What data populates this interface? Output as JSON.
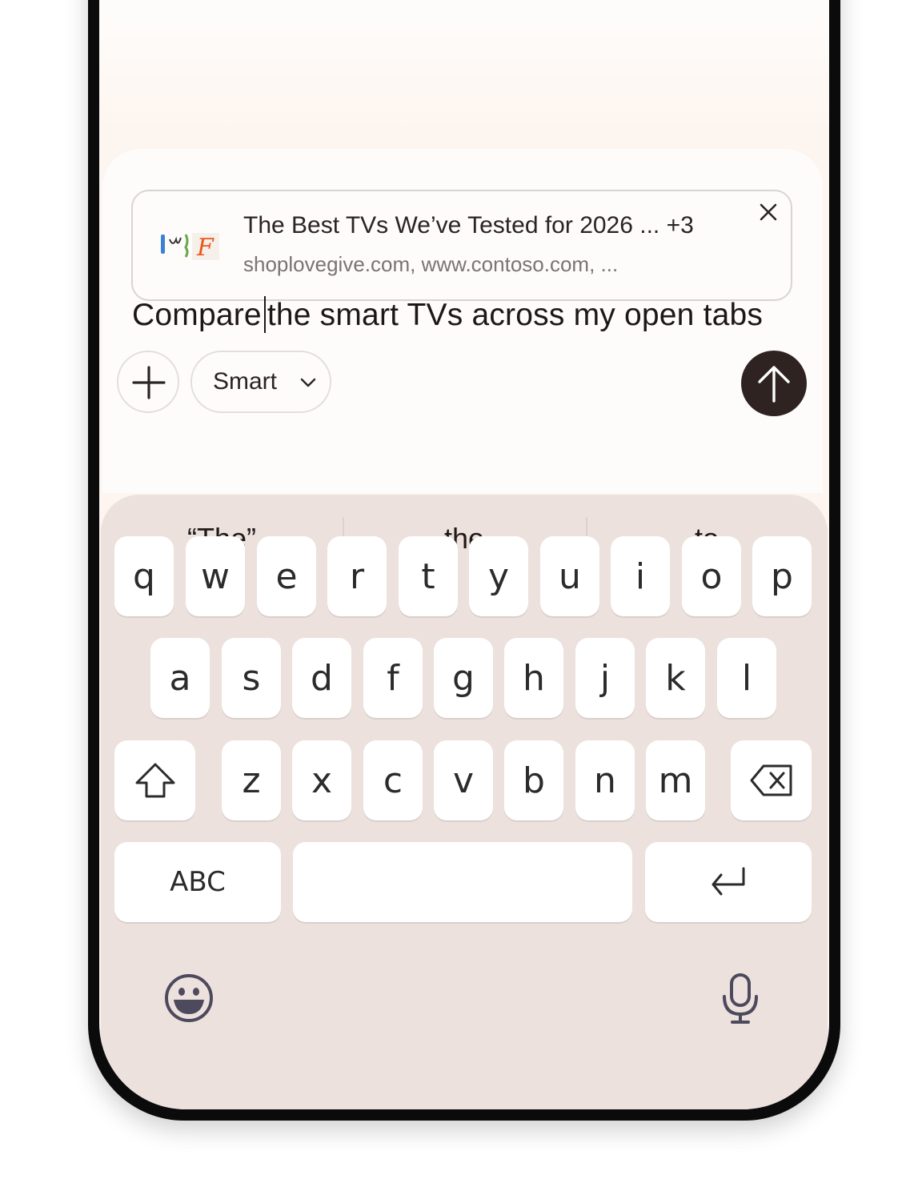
{
  "attached_tabs": {
    "title": "The Best TVs We’ve Tested for 2026 ... +3",
    "sites": "shoplovegive.com, www.contoso.com, ...",
    "favicon_icons": [
      "blue-bar-favicon",
      "leaf-sketch-favicon",
      "green-sprig-favicon",
      "orange-f-favicon"
    ]
  },
  "prompt": {
    "before_caret": "Compare",
    "after_caret": "the smart TVs across my open tabs"
  },
  "composer": {
    "mode_label": "Smart",
    "add_icon": "plus-icon",
    "mode_icon": "chevron-down-icon",
    "send_icon": "arrow-up-icon"
  },
  "keyboard": {
    "suggestions": [
      "“The”",
      "the",
      "to"
    ],
    "row1": [
      "q",
      "w",
      "e",
      "r",
      "t",
      "y",
      "u",
      "i",
      "o",
      "p"
    ],
    "row2": [
      "a",
      "s",
      "d",
      "f",
      "g",
      "h",
      "j",
      "k",
      "l"
    ],
    "row3": [
      "z",
      "x",
      "c",
      "v",
      "b",
      "n",
      "m"
    ],
    "abc_label": "ABC",
    "shift_icon": "shift-arrow-icon",
    "backspace_icon": "backspace-icon",
    "enter_icon": "enter-return-icon",
    "emoji_icon": "smiley-emoji-icon",
    "mic_icon": "microphone-icon"
  },
  "colors": {
    "send_button": "#2e2321",
    "keyboard_bg": "#ece1dc",
    "key_bg": "#ffffff",
    "screen_bg": "#fdf5ef"
  }
}
